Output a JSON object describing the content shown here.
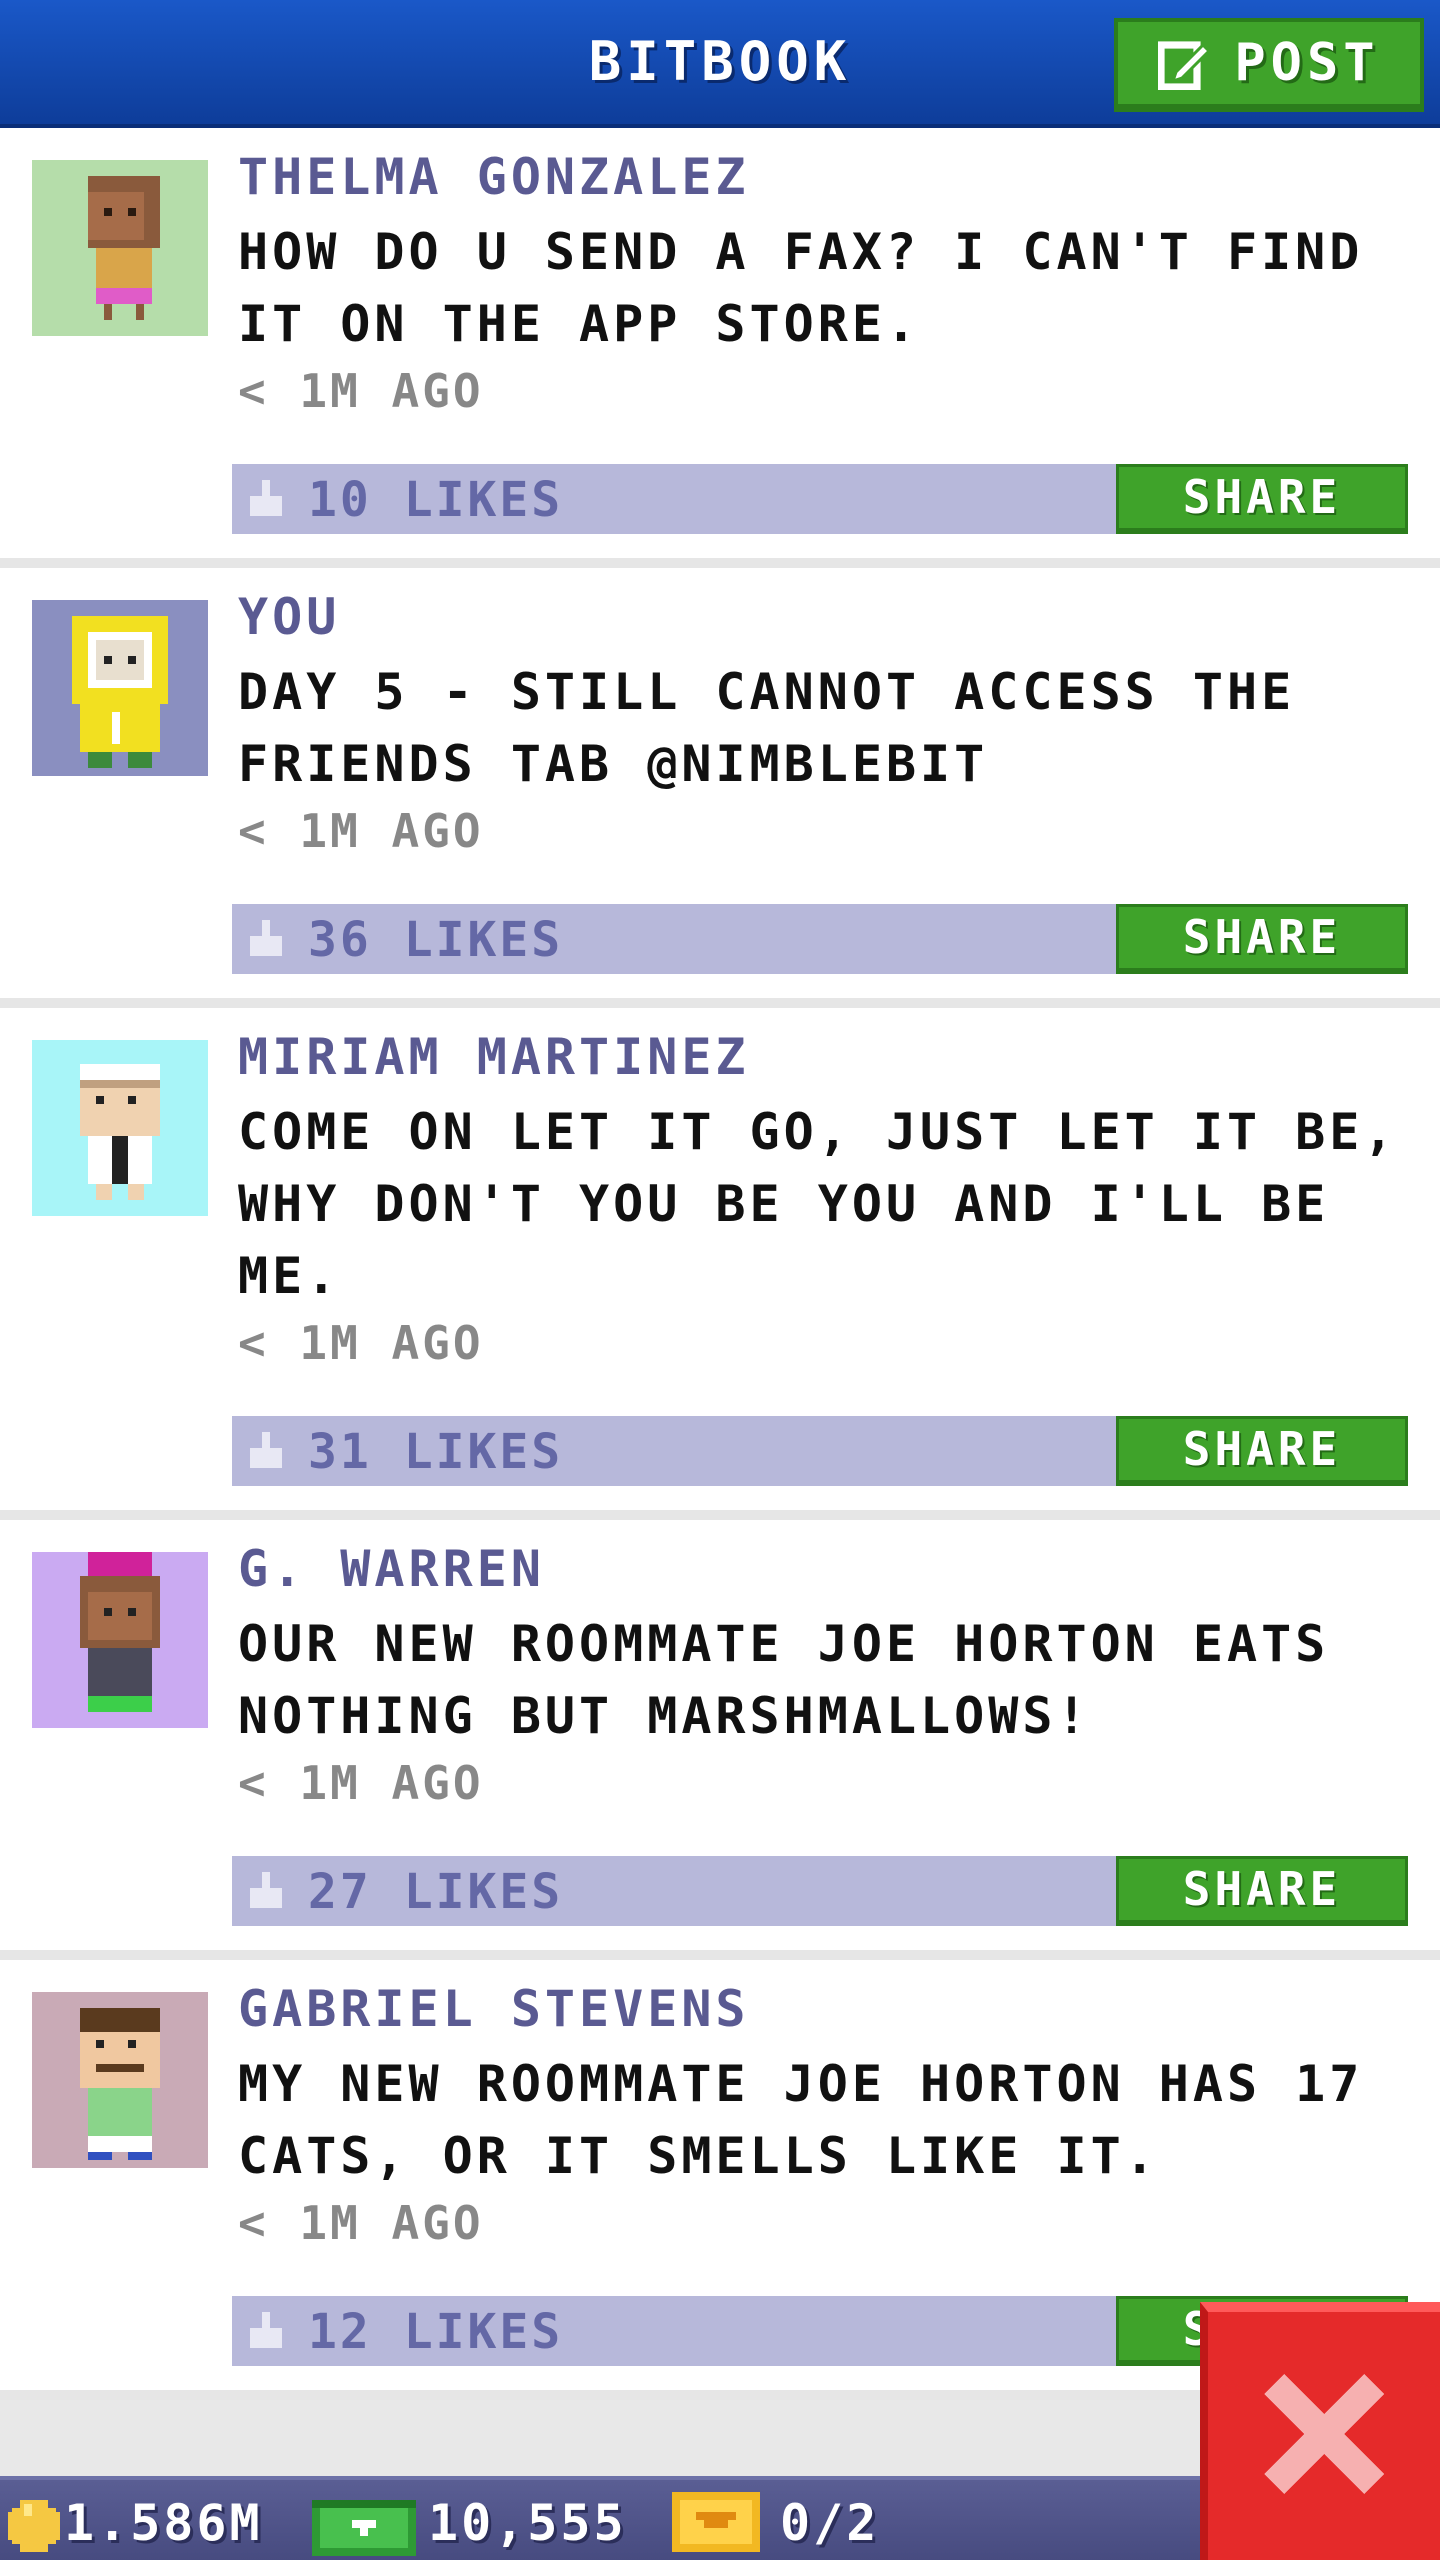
{
  "header": {
    "title": "BITBOOK",
    "post_label": "POST"
  },
  "posts": [
    {
      "author": "THELMA GONZALEZ",
      "text": "HOW DO U SEND A FAX? I CAN'T FIND IT ON THE APP STORE.",
      "time": "< 1M AGO",
      "likes": "10 LIKES",
      "share_label": "SHARE",
      "avatar_bg": "#b5ddaa"
    },
    {
      "author": "YOU",
      "text": "DAY 5 - STILL CANNOT ACCESS THE FRIENDS TAB @NIMBLEBIT",
      "time": "< 1M AGO",
      "likes": "36 LIKES",
      "share_label": "SHARE",
      "avatar_bg": "#8a8fc0"
    },
    {
      "author": "MIRIAM MARTINEZ",
      "text": "COME ON LET IT GO, JUST LET IT BE, WHY DON'T YOU BE YOU AND I'LL BE ME.",
      "time": "< 1M AGO",
      "likes": "31 LIKES",
      "share_label": "SHARE",
      "avatar_bg": "#a8f5f8"
    },
    {
      "author": "G. WARREN",
      "text": "OUR NEW ROOMMATE JOE HORTON EATS NOTHING BUT MARSHMALLOWS!",
      "time": "< 1M AGO",
      "likes": "27 LIKES",
      "share_label": "SHARE",
      "avatar_bg": "#caaaf2"
    },
    {
      "author": "GABRIEL STEVENS",
      "text": "MY NEW ROOMMATE JOE HORTON HAS 17 CATS, OR IT SMELLS LIKE IT.",
      "time": "< 1M AGO",
      "likes": "12 LIKES",
      "share_label": "SHARE",
      "avatar_bg": "#c9aab6"
    }
  ],
  "footer": {
    "coins": "1.586M",
    "bux": "10,555",
    "tickets": "0/2"
  },
  "colors": {
    "header_blue": "#1a58c8",
    "button_green": "#3fa32a",
    "author_purple": "#5a5a92",
    "like_bar": "#b7b8da",
    "close_red": "#e52a2a"
  }
}
